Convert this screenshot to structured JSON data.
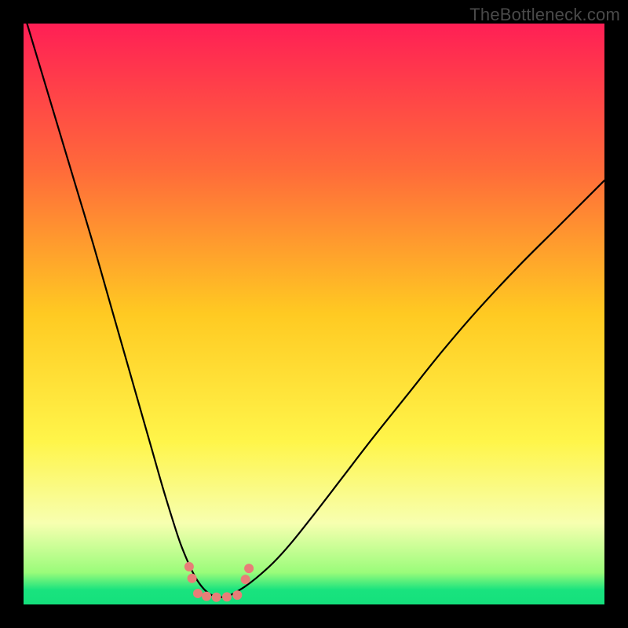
{
  "watermark": "TheBottleneck.com",
  "chart_data": {
    "type": "line",
    "title": "",
    "xlabel": "",
    "ylabel": "",
    "xlim": [
      0,
      100
    ],
    "ylim": [
      0,
      100
    ],
    "grid": false,
    "legend": "none",
    "background_gradient": {
      "stops": [
        {
          "offset": 0.0,
          "color": "#ff1f55"
        },
        {
          "offset": 0.25,
          "color": "#ff6a3a"
        },
        {
          "offset": 0.5,
          "color": "#ffca22"
        },
        {
          "offset": 0.72,
          "color": "#fff54a"
        },
        {
          "offset": 0.86,
          "color": "#f7ffb0"
        },
        {
          "offset": 0.945,
          "color": "#9afc7a"
        },
        {
          "offset": 0.975,
          "color": "#19e37e"
        },
        {
          "offset": 1.0,
          "color": "#14e07c"
        }
      ]
    },
    "annotations": [],
    "series": [
      {
        "name": "left-curve",
        "color": "#000000",
        "width": 2.2,
        "x": [
          0,
          3,
          6,
          9,
          12,
          15,
          18,
          20,
          22,
          24,
          26,
          27,
          28,
          29,
          30,
          31,
          32
        ],
        "y": [
          102,
          92,
          82,
          72,
          62,
          51.5,
          41,
          34,
          27,
          20,
          13.5,
          10.5,
          8,
          5.8,
          4,
          2.7,
          1.8
        ]
      },
      {
        "name": "right-curve",
        "color": "#000000",
        "width": 2.2,
        "x": [
          36,
          38,
          40,
          43,
          46,
          50,
          55,
          60,
          66,
          72,
          78,
          85,
          92,
          100
        ],
        "y": [
          1.8,
          3.0,
          4.5,
          7.2,
          10.5,
          15.5,
          22,
          28.5,
          36,
          43.5,
          50.5,
          58,
          65,
          73
        ]
      },
      {
        "name": "valley-floor",
        "color": "#000000",
        "width": 2.2,
        "x": [
          32,
          33,
          34,
          35,
          36
        ],
        "y": [
          1.8,
          1.4,
          1.25,
          1.4,
          1.8
        ]
      }
    ],
    "markers": [
      {
        "name": "dot-left-upper",
        "x": 28.5,
        "y": 6.5,
        "r": 6,
        "color": "#e77e78"
      },
      {
        "name": "dot-left-lower",
        "x": 29.0,
        "y": 4.5,
        "r": 6,
        "color": "#e77e78"
      },
      {
        "name": "dot-right-upper",
        "x": 38.8,
        "y": 6.2,
        "r": 6,
        "color": "#e77e78"
      },
      {
        "name": "dot-right-lower",
        "x": 38.2,
        "y": 4.3,
        "r": 6,
        "color": "#e77e78"
      },
      {
        "name": "dot-floor-1",
        "x": 30.0,
        "y": 1.9,
        "r": 6,
        "color": "#e77e78"
      },
      {
        "name": "dot-floor-2",
        "x": 31.5,
        "y": 1.4,
        "r": 6,
        "color": "#e77e78"
      },
      {
        "name": "dot-floor-3",
        "x": 33.2,
        "y": 1.25,
        "r": 6,
        "color": "#e77e78"
      },
      {
        "name": "dot-floor-4",
        "x": 35.0,
        "y": 1.3,
        "r": 6,
        "color": "#e77e78"
      },
      {
        "name": "dot-floor-5",
        "x": 36.8,
        "y": 1.6,
        "r": 6,
        "color": "#e77e78"
      }
    ]
  }
}
